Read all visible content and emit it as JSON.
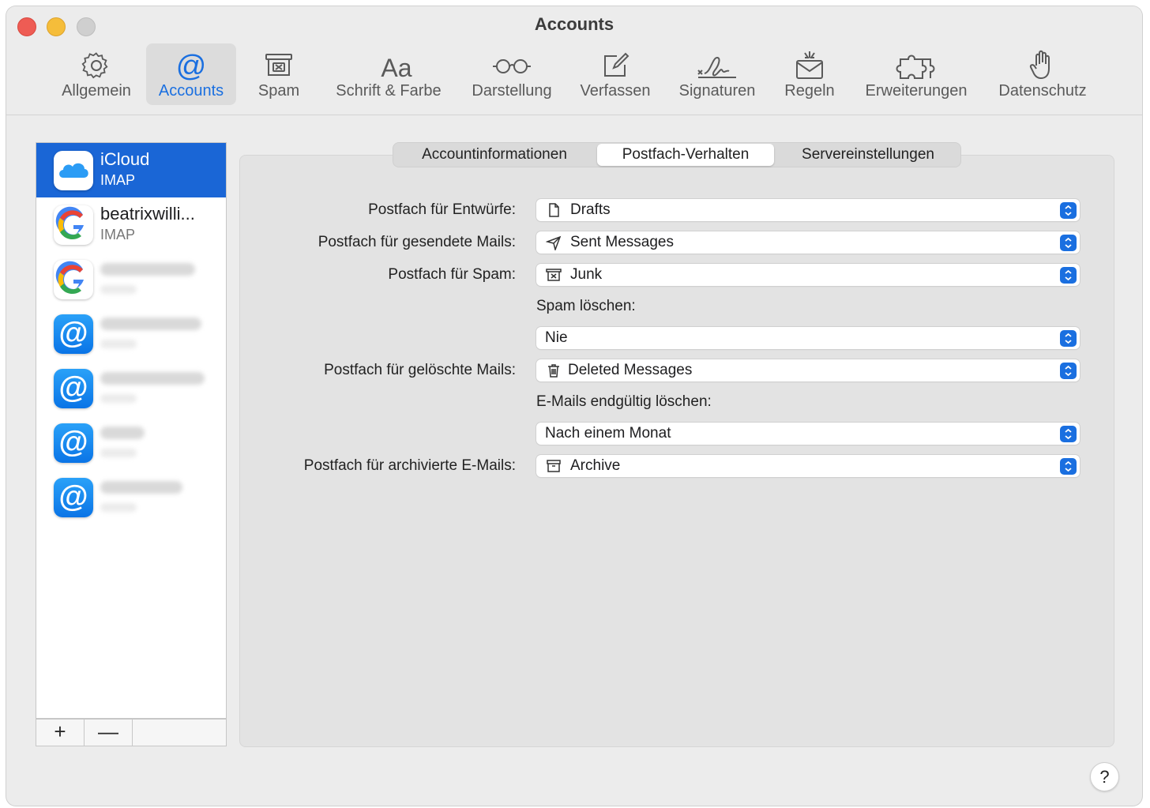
{
  "window": {
    "title": "Accounts"
  },
  "toolbar": {
    "items": [
      {
        "label": "Allgemein",
        "icon": "gear-icon"
      },
      {
        "label": "Accounts",
        "icon": "at-icon",
        "active": true
      },
      {
        "label": "Spam",
        "icon": "junk-box-icon"
      },
      {
        "label": "Schrift & Farbe",
        "icon": "font-icon"
      },
      {
        "label": "Darstellung",
        "icon": "glasses-icon"
      },
      {
        "label": "Verfassen",
        "icon": "compose-icon"
      },
      {
        "label": "Signaturen",
        "icon": "signature-icon"
      },
      {
        "label": "Regeln",
        "icon": "rules-envelope-icon"
      },
      {
        "label": "Erweiterungen",
        "icon": "puzzle-icon"
      },
      {
        "label": "Datenschutz",
        "icon": "hand-icon"
      }
    ]
  },
  "sidebar": {
    "accounts": [
      {
        "name": "iCloud",
        "type": "IMAP",
        "icon": "icloud-icon",
        "selected": true
      },
      {
        "name": "beatrixwilli...",
        "type": "IMAP",
        "icon": "google-icon"
      },
      {
        "icon": "google-icon",
        "blurred": true
      },
      {
        "icon": "at-mail-icon",
        "blurred": true
      },
      {
        "icon": "at-mail-icon",
        "blurred": true
      },
      {
        "icon": "at-mail-icon",
        "blurred": true
      },
      {
        "icon": "at-mail-icon",
        "blurred": true
      }
    ],
    "add_label": "+",
    "remove_label": "—"
  },
  "tabs": [
    {
      "label": "Accountinformationen"
    },
    {
      "label": "Postfach-Verhalten",
      "active": true
    },
    {
      "label": "Servereinstellungen"
    }
  ],
  "form": {
    "drafts": {
      "label": "Postfach für Entwürfe:",
      "value": "Drafts",
      "icon": "document-icon"
    },
    "sent": {
      "label": "Postfach für gesendete Mails:",
      "value": "Sent Messages",
      "icon": "paper-plane-icon"
    },
    "spam": {
      "label": "Postfach für Spam:",
      "value": "Junk",
      "icon": "junk-box-icon"
    },
    "spam_delete": {
      "label": "Spam löschen:",
      "value": "Nie"
    },
    "trash": {
      "label": "Postfach für gelöschte Mails:",
      "value": "Deleted Messages",
      "icon": "trash-icon"
    },
    "erase": {
      "label": "E-Mails endgültig löschen:",
      "value": "Nach einem Monat"
    },
    "archive": {
      "label": "Postfach für archivierte E-Mails:",
      "value": "Archive",
      "icon": "archive-box-icon"
    }
  },
  "help_label": "?",
  "colors": {
    "accent": "#1a6fe0",
    "selection": "#1a66d6"
  }
}
